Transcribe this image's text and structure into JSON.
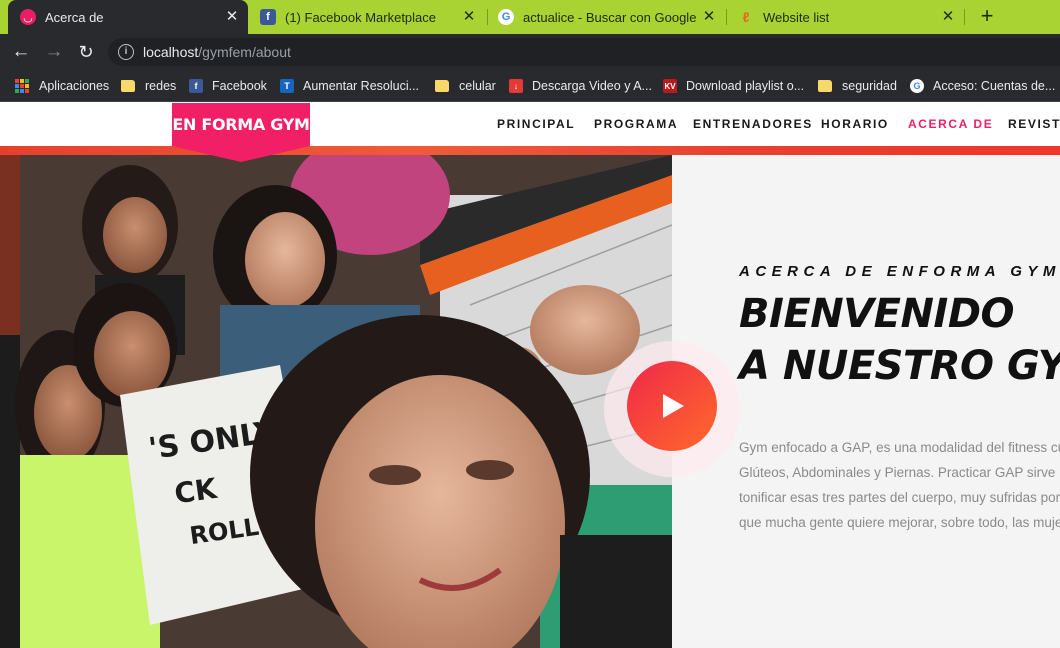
{
  "browser": {
    "tabs": [
      {
        "title": "Acerca de",
        "icon": "gym-favicon-icon",
        "active": true
      },
      {
        "title": "(1) Facebook Marketplace",
        "icon": "facebook-icon"
      },
      {
        "title": "actualice - Buscar con Google",
        "icon": "google-icon"
      },
      {
        "title": "Website list",
        "icon": "website-list-icon"
      }
    ],
    "close_glyph": "✕",
    "newtab_glyph": "+",
    "url_host": "localhost",
    "url_path": "/gymfem/about",
    "bookmarks": [
      {
        "label": "Aplicaciones",
        "icon": "apps-grid-icon"
      },
      {
        "label": "redes",
        "icon": "folder-icon"
      },
      {
        "label": "Facebook",
        "icon": "facebook-icon"
      },
      {
        "label": "Aumentar Resoluci...",
        "icon": "t-icon"
      },
      {
        "label": "celular",
        "icon": "folder-icon"
      },
      {
        "label": "Descarga Video y A...",
        "icon": "download-icon"
      },
      {
        "label": "Download playlist o...",
        "icon": "kv-icon"
      },
      {
        "label": "seguridad",
        "icon": "folder-icon"
      },
      {
        "label": "Acceso: Cuentas de...",
        "icon": "google-icon"
      }
    ]
  },
  "site": {
    "logo": "EN FORMA GYM",
    "nav": [
      {
        "label": "PRINCIPAL"
      },
      {
        "label": "PROGRAMA"
      },
      {
        "label": "ENTRENADORES"
      },
      {
        "label": "HORARIO"
      },
      {
        "label": "ACERCA DE",
        "active": true
      },
      {
        "label": "REVISTA"
      }
    ],
    "about": {
      "kicker": "ACERCA DE ENFORMA GYM",
      "headline_line1": "BIENVENIDO",
      "headline_line2": "A NUESTRO GYM",
      "paragraph_lines": [
        "Gym enfocado a GAP, es una modalidad del fitness cuyas s",
        "Glúteos, Abdominales y Piernas. Practicar GAP sirve para f",
        "tonificar esas tres partes del cuerpo, muy sufridas por la v",
        "que mucha gente quiere mejorar, sobre todo, las mujeres."
      ]
    },
    "photo_shirt_text_1": "'S ONLY",
    "photo_shirt_text_2": "CK",
    "photo_shirt_text_3": "ROLL"
  },
  "colors": {
    "accent": "#f01f66",
    "tabbar": "#a8d332",
    "chrome_dark": "#292a2d"
  }
}
